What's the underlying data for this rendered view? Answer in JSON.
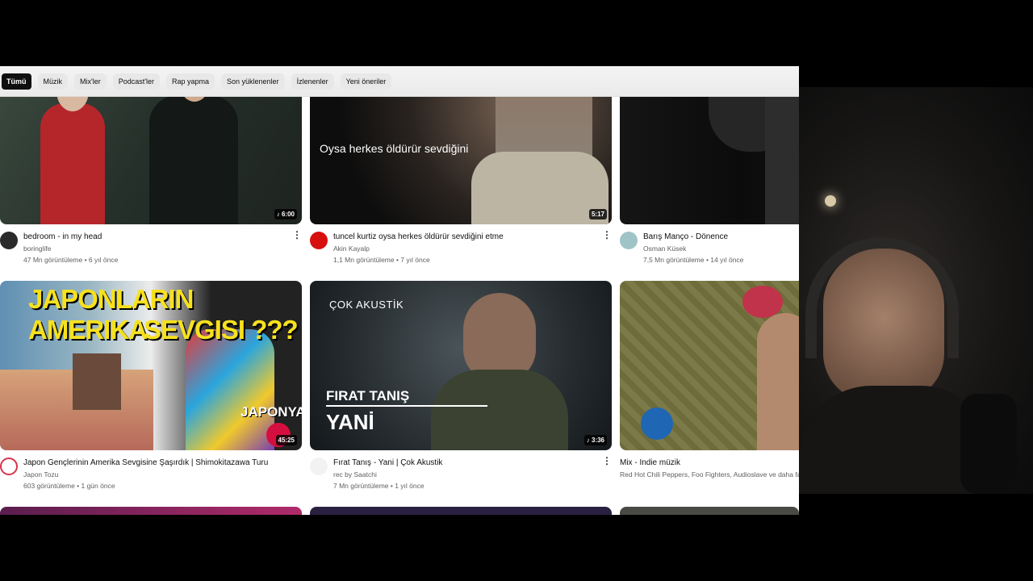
{
  "chips": [
    "Tümü",
    "Müzik",
    "Mix'ler",
    "Podcast'ler",
    "Rap yapma",
    "Son yüklenenler",
    "İzlenenler",
    "Yeni öneriler"
  ],
  "videos": [
    {
      "title": "bedroom - in my head",
      "channel": "boringlife",
      "stats": "47 Mn görüntüleme • 6 yıl önce",
      "duration": "♪ 6:00",
      "thumb_color": "#2f3a33"
    },
    {
      "title": "tuncel kurtiz oysa herkes öldürür sevdiğini etme",
      "channel": "Akin Kayalp",
      "stats": "1,1 Mn görüntüleme • 7 yıl önce",
      "duration": "5:17",
      "overlay": "Oysa herkes öldürür sevdiğini",
      "thumb_color": "#1a1a1a"
    },
    {
      "title": "Barış Manço - Dönence",
      "channel": "Osman Küsek",
      "stats": "7,5 Mn görüntüleme • 14 yıl önce",
      "duration": "",
      "thumb_color": "#111111"
    },
    {
      "title": "Japon Gençlerinin Amerika Sevgisine Şaşırdık | Shimokitazawa Turu",
      "channel": "Japon Tozu",
      "stats": "603 görüntüleme • 1 gün önce",
      "duration": "45:25",
      "overlay_line1": "JAPONLARIN AMERIKA",
      "overlay_line2": "SEVGISI ???",
      "overlay_badge": "JAPONYA",
      "thumb_color": "#c9b99a"
    },
    {
      "title": "Fırat Tanış - Yani | Çok Akustik",
      "channel": "rec by Saatchi",
      "stats": "7 Mn görüntüleme • 1 yıl önce",
      "duration": "♪ 3:36",
      "overlay_brand": "ÇOK AKUSTİK",
      "overlay_name": "FIRAT TANIŞ",
      "overlay_song": "YANİ",
      "thumb_color": "#2c3438"
    },
    {
      "title": "Mix - Indie müzik",
      "channel": "Red Hot Chili Peppers, Foo Fighters, Audioslave ve daha fazlası",
      "stats": "",
      "duration": "",
      "thumb_color": "#6b6a3c"
    }
  ],
  "colors": {
    "chip_active_bg": "#0f0f0f",
    "text_primary": "#0f0f0f",
    "text_secondary": "#606060"
  }
}
